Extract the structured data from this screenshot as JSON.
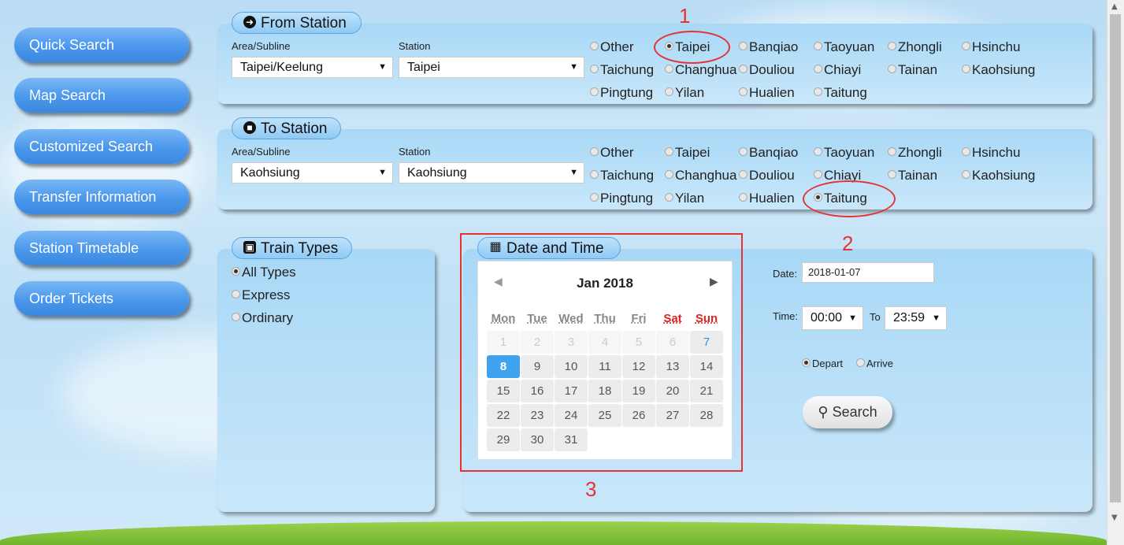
{
  "nav": {
    "items": [
      {
        "label": "Quick Search"
      },
      {
        "label": "Map Search"
      },
      {
        "label": "Customized Search"
      },
      {
        "label": "Transfer Information"
      },
      {
        "label": "Station Timetable"
      },
      {
        "label": "Order Tickets"
      }
    ]
  },
  "from_station": {
    "title": "From Station",
    "area_label": "Area/Subline",
    "station_label": "Station",
    "area_value": "Taipei/Keelung",
    "station_value": "Taipei",
    "options": [
      "Other",
      "Taipei",
      "Banqiao",
      "Taoyuan",
      "Zhongli",
      "Hsinchu",
      "Taichung",
      "Changhua",
      "Douliou",
      "Chiayi",
      "Tainan",
      "Kaohsiung",
      "Pingtung",
      "Yilan",
      "Hualien",
      "Taitung"
    ],
    "selected": "Taipei"
  },
  "to_station": {
    "title": "To Station",
    "area_label": "Area/Subline",
    "station_label": "Station",
    "area_value": "Kaohsiung",
    "station_value": "Kaohsiung",
    "options": [
      "Other",
      "Taipei",
      "Banqiao",
      "Taoyuan",
      "Zhongli",
      "Hsinchu",
      "Taichung",
      "Changhua",
      "Douliou",
      "Chiayi",
      "Tainan",
      "Kaohsiung",
      "Pingtung",
      "Yilan",
      "Hualien",
      "Taitung"
    ],
    "selected": "Taitung"
  },
  "train_types": {
    "title": "Train Types",
    "options": [
      "All Types",
      "Express",
      "Ordinary"
    ],
    "selected": "All Types"
  },
  "datetime": {
    "title": "Date and Time",
    "calendar": {
      "month": "Jan",
      "year": "2018",
      "weekdays": [
        "Mon",
        "Tue",
        "Wed",
        "Thu",
        "Fri",
        "Sat",
        "Sun"
      ],
      "leading_days": [
        "1",
        "2",
        "3",
        "4",
        "5",
        "6"
      ],
      "days": [
        "7",
        "8",
        "9",
        "10",
        "11",
        "12",
        "13",
        "14",
        "15",
        "16",
        "17",
        "18",
        "19",
        "20",
        "21",
        "22",
        "23",
        "24",
        "25",
        "26",
        "27",
        "28",
        "29",
        "30",
        "31"
      ],
      "selected_day": "8"
    },
    "date_label": "Date:",
    "date_value": "2018-01-07",
    "time_label": "Time:",
    "time_from": "00:00",
    "to_label": "To",
    "time_to": "23:59",
    "mode_options": [
      "Depart",
      "Arrive"
    ],
    "mode_selected": "Depart",
    "search_label": "Search"
  },
  "annotations": [
    "1",
    "2",
    "3"
  ],
  "colors": {
    "nav_button": "#4a97ec",
    "highlight": "#e53333",
    "selected_day": "#3fa2ef"
  },
  "icons": [
    "arrow-circle-right-icon",
    "stop-circle-icon",
    "train-icon",
    "calendar-icon",
    "search-icon",
    "caret-down-icon",
    "chevron-left-icon",
    "chevron-right-icon"
  ]
}
